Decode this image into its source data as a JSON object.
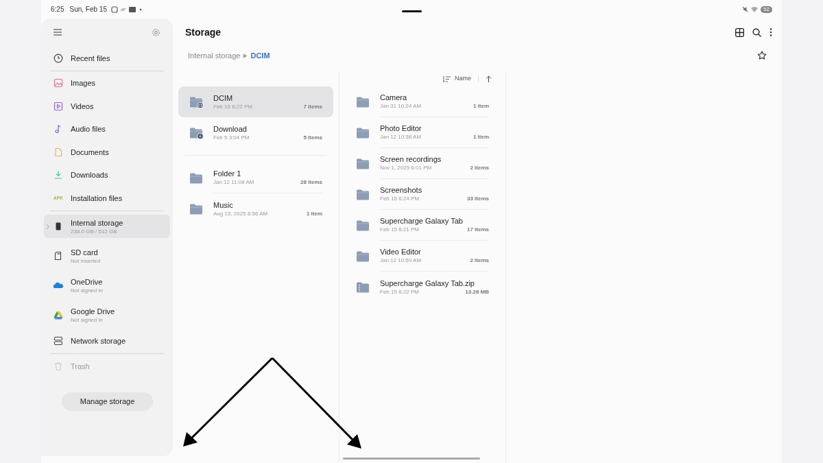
{
  "status_bar": {
    "time": "6:25",
    "date": "Sun, Feb 15",
    "battery": "52"
  },
  "sidebar": {
    "sections": [
      {
        "items": [
          {
            "label": "Recent files",
            "selected": false
          }
        ]
      },
      {
        "items": [
          {
            "label": "Images",
            "selected": false
          },
          {
            "label": "Videos",
            "selected": false
          },
          {
            "label": "Audio files",
            "selected": false
          },
          {
            "label": "Documents",
            "selected": false
          },
          {
            "label": "Downloads",
            "selected": false
          },
          {
            "label": "Installation files",
            "badge": "APK",
            "selected": false
          }
        ]
      },
      {
        "items": [
          {
            "label": "Internal storage",
            "sublabel": "238.0 GB / 512 GB",
            "selected": true
          },
          {
            "label": "SD card",
            "sublabel": "Not inserted",
            "selected": false
          },
          {
            "label": "OneDrive",
            "sublabel": "Not signed in",
            "selected": false
          },
          {
            "label": "Google Drive",
            "sublabel": "Not signed in",
            "selected": false
          },
          {
            "label": "Network storage",
            "selected": false
          }
        ]
      },
      {
        "items": [
          {
            "label": "Trash",
            "disabled": true,
            "selected": false
          }
        ]
      }
    ],
    "button": "Manage storage"
  },
  "main": {
    "title": "Storage",
    "breadcrumb": [
      "Internal storage",
      "DCIM"
    ],
    "left_pane": {
      "groups": [
        [
          {
            "kind": "camera-folder",
            "name": "DCIM",
            "date": "Feb 15 6:22 PM",
            "count": "7 items",
            "selected": true
          },
          {
            "kind": "download-folder",
            "name": "Download",
            "date": "Feb 5 3:04 PM",
            "count": "5 items",
            "selected": false
          }
        ],
        [
          {
            "kind": "folder",
            "name": "Folder 1",
            "date": "Jan 12 11:08 AM",
            "count": "28 items",
            "selected": false
          },
          {
            "kind": "folder",
            "name": "Music",
            "date": "Aug 15, 2025 8:56 AM",
            "count": "1 item",
            "selected": false
          }
        ]
      ]
    },
    "right_pane": {
      "sort": {
        "label": "Name",
        "ascending": true
      },
      "items": [
        {
          "kind": "folder",
          "name": "Camera",
          "date": "Jan 31 10:24 AM",
          "count": "1 item",
          "selected": false
        },
        {
          "kind": "folder",
          "name": "Photo Editor",
          "date": "Jan 12 10:38 AM",
          "count": "1 item",
          "selected": false
        },
        {
          "kind": "folder",
          "name": "Screen recordings",
          "date": "Nov 1, 2025 6:01 PM",
          "count": "2 items",
          "selected": false
        },
        {
          "kind": "folder",
          "name": "Screenshots",
          "date": "Feb 15 6:24 PM",
          "count": "33 items",
          "selected": false
        },
        {
          "kind": "folder",
          "name": "Supercharge Galaxy Tab",
          "date": "Feb 15 6:21 PM",
          "count": "17 items",
          "selected": false
        },
        {
          "kind": "folder",
          "name": "Video Editor",
          "date": "Jan 12 10:59 AM",
          "count": "2 items",
          "selected": false
        },
        {
          "kind": "zip",
          "name": "Supercharge Galaxy Tab.zip",
          "date": "Feb 15 6:22 PM",
          "count": "13.28 MB",
          "selected": false
        }
      ]
    }
  }
}
